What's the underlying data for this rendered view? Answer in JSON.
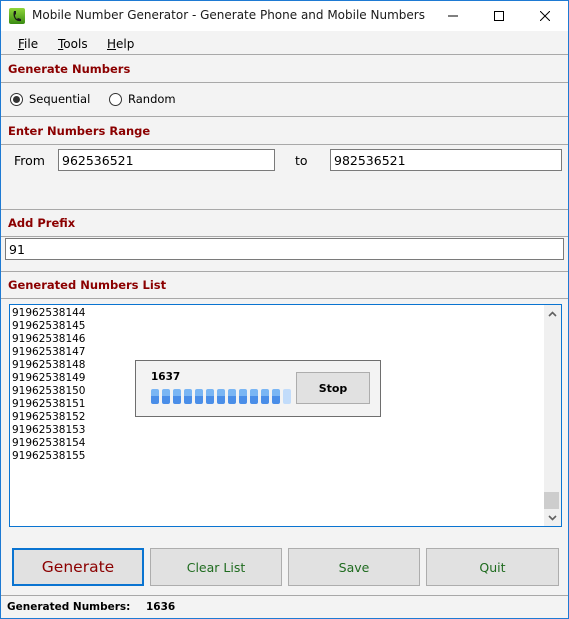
{
  "window": {
    "title": "Mobile Number Generator - Generate Phone and Mobile Numbers",
    "icon": "phone-app-icon",
    "controls": [
      "minimize",
      "maximize",
      "close"
    ]
  },
  "menu": {
    "items": [
      {
        "label": "File",
        "mnemonic": "F"
      },
      {
        "label": "Tools",
        "mnemonic": "T"
      },
      {
        "label": "Help",
        "mnemonic": "H"
      }
    ]
  },
  "generate_numbers": {
    "header": "Generate Numbers",
    "options": [
      {
        "label": "Sequential",
        "selected": true
      },
      {
        "label": "Random",
        "selected": false
      }
    ]
  },
  "range": {
    "header": "Enter Numbers Range",
    "from_label": "From",
    "from_value": "962536521",
    "to_label": "to",
    "to_value": "982536521"
  },
  "prefix": {
    "header": "Add Prefix",
    "value": "91"
  },
  "list": {
    "header": "Generated Numbers List",
    "items": [
      "91962538144",
      "91962538145",
      "91962538146",
      "91962538147",
      "91962538148",
      "91962538149",
      "91962538150",
      "91962538151",
      "91962538152",
      "91962538153",
      "91962538154",
      "91962538155"
    ]
  },
  "progress": {
    "count": "1637",
    "segments_filled": 12,
    "segments_total": 13,
    "stop_label": "Stop"
  },
  "buttons": {
    "generate": "Generate",
    "clear": "Clear List",
    "save": "Save",
    "quit": "Quit"
  },
  "status": {
    "label": "Generated Numbers:",
    "value": "1636"
  },
  "colors": {
    "header_text": "#8b0000",
    "generate_text": "#8b0000",
    "button_text": "#1f6b1f",
    "focus_border": "#0a74d1"
  }
}
